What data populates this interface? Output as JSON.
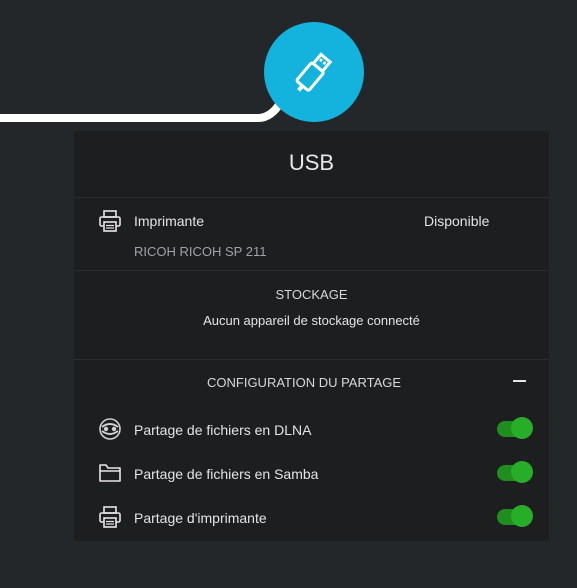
{
  "header": {
    "title": "USB"
  },
  "printer": {
    "label": "Imprimante",
    "status": "Disponible",
    "model": "RICOH RICOH SP 211"
  },
  "storage": {
    "title": "STOCKAGE",
    "message": "Aucun appareil de stockage connecté"
  },
  "sharing": {
    "title": "CONFIGURATION DU PARTAGE",
    "items": [
      {
        "label": "Partage de fichiers en DLNA",
        "icon": "dlna-icon",
        "enabled": true
      },
      {
        "label": "Partage de fichiers en Samba",
        "icon": "folder-icon",
        "enabled": true
      },
      {
        "label": "Partage d'imprimante",
        "icon": "printer-icon",
        "enabled": true
      }
    ]
  },
  "colors": {
    "accent": "#14b3dd",
    "toggle_on": "#27ad27",
    "background": "#242729",
    "panel": "#1c1e20"
  }
}
